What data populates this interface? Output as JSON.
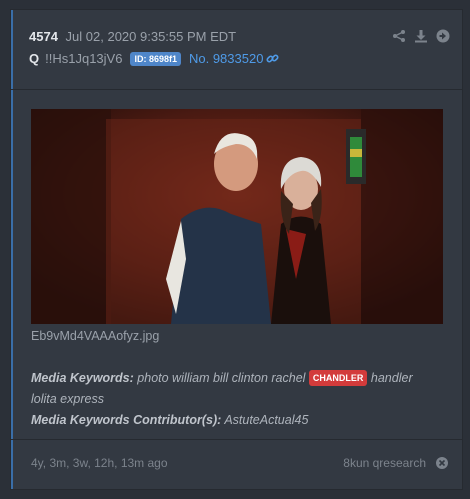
{
  "post": {
    "number": "4574",
    "date": "Jul 02, 2020 9:35:55 PM EDT",
    "author": "Q",
    "tripcode": "!!Hs1Jq13jV6",
    "id_badge": "ID: 8698f1",
    "post_link": "No. 9833520"
  },
  "actions": {
    "icons": [
      "share-icon",
      "download-icon",
      "arrow-right-circle-icon"
    ]
  },
  "image": {
    "filename": "Eb9vMd4VAAAofyz.jpg"
  },
  "keywords": {
    "label": "Media Keywords:",
    "text_before": "photo william bill clinton rachel",
    "highlight": "CHANDLER",
    "text_after": "handler lolita express",
    "contributor_label": "Media Keywords Contributor(s):",
    "contributor": "AstuteActual45"
  },
  "footer": {
    "age": "4y, 3m, 3w, 12h, 13m ago",
    "source": "8kun qresearch"
  },
  "colors": {
    "background": "#2b3038",
    "card": "#333942",
    "accent_link": "#4f9be8",
    "id_badge": "#4f86c9",
    "highlight_badge": "#d33b3b"
  }
}
